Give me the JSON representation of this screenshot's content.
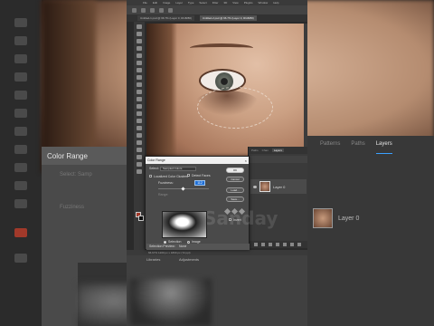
{
  "background": {
    "color_range_title": "Color Range",
    "select_label": "Select:",
    "select_value": "Samp",
    "fuzziness_label": "Fuzziness",
    "layer_name": "Layer 0",
    "panel_tabs": [
      "Patterns",
      "Paths",
      "Layers"
    ]
  },
  "app": {
    "menu": [
      "File",
      "Edit",
      "Image",
      "Layer",
      "Type",
      "Select",
      "Filter",
      "3D",
      "View",
      "Plugins",
      "Window",
      "Help"
    ],
    "tabs": [
      {
        "label": "Untitled-1.psd @ 66.7% (Layer 0, RGB/8#)",
        "active": true
      },
      {
        "label": "Untitled-2.psd @ 66.7% (Layer 0, RGB/8#)",
        "active": false
      }
    ],
    "status": "66.67%  1200 px x 1800 px (72 ppi)",
    "bottom_tabs": [
      "Libraries",
      "Adjustments"
    ]
  },
  "layers_panel": {
    "tabs": [
      "Paths",
      "Chan",
      "Layers"
    ],
    "active_tab": "Layers",
    "layer_name": "Layer 0"
  },
  "dialog": {
    "title": "Color Range",
    "close": "×",
    "select_label": "Select:",
    "select_value": "Sampled Colors",
    "detect_faces": "Detect Faces",
    "localized_clusters": "Localized Color Clusters",
    "fuzziness_label": "Fuzziness:",
    "fuzziness_value": "112",
    "range_label": "Range:",
    "selection_label": "Selection",
    "image_label": "Image",
    "selection_preview_label": "Selection Preview:",
    "selection_preview_value": "None",
    "invert_label": "Invert",
    "buttons": {
      "ok": "OK",
      "cancel": "Cancel",
      "load": "Load...",
      "save": "Save..."
    },
    "watermark": "Sanday"
  },
  "colors": {
    "foreground_swatch": "#a1392a",
    "background_swatch": "#111111",
    "accent": "#1f6fd6"
  }
}
